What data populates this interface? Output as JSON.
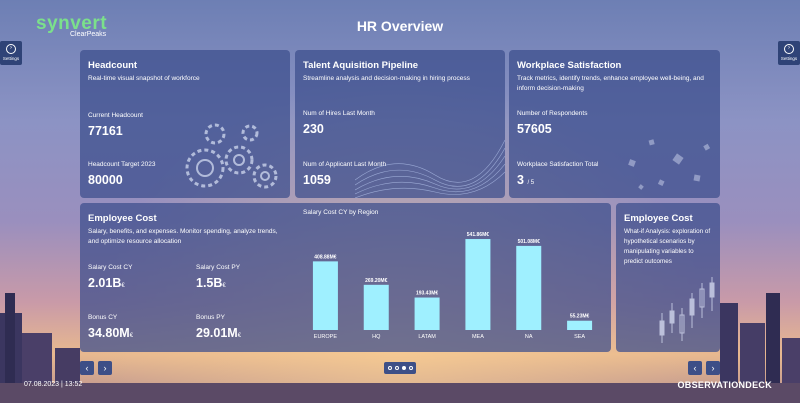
{
  "header": {
    "title": "HR Overview",
    "logo_main": "synvert",
    "logo_sub": "ClearPeaks"
  },
  "settings_left": {
    "label": "Settings"
  },
  "settings_right": {
    "label": "Settings"
  },
  "headcount": {
    "title": "Headcount",
    "desc": "Real-time visual snapshot of workforce",
    "current_label": "Current Headcount",
    "current_value": "77161",
    "target_label": "Headcount Target 2023",
    "target_value": "80000"
  },
  "talent": {
    "title": "Talent Aquisition Pipeline",
    "desc": "Streamline analysis and decision-making in hiring process",
    "hires_label": "Num of Hires Last Month",
    "hires_value": "230",
    "applicants_label": "Num of Applicant Last Month",
    "applicants_value": "1059"
  },
  "satisfaction": {
    "title": "Workplace Satisfaction",
    "desc": "Track metrics, identify trends, enhance employee well-being, and inform decision-making",
    "respondents_label": "Number of Respondents",
    "respondents_value": "57605",
    "total_label": "Workplace Satisfaction Total",
    "total_value": "3",
    "total_suffix": "/ 5"
  },
  "cost": {
    "title": "Employee Cost",
    "desc": "Salary, benefits, and expenses. Monitor spending, analyze trends, and optimize resource allocation",
    "salary_cy_label": "Salary Cost CY",
    "salary_cy_value": "2.01B",
    "salary_cy_unit": "€",
    "salary_py_label": "Salary Cost PY",
    "salary_py_value": "1.5B",
    "salary_py_unit": "€",
    "bonus_cy_label": "Bonus CY",
    "bonus_cy_value": "34.80M",
    "bonus_cy_unit": "€",
    "bonus_py_label": "Bonus PY",
    "bonus_py_value": "29.01M",
    "bonus_py_unit": "€"
  },
  "whatif": {
    "title": "Employee Cost",
    "desc": "What-if Analysis: exploration of hypothetical scenarios by manipulating variables to predict outcomes"
  },
  "chart_data": {
    "type": "bar",
    "title": "Salary Cost CY by Region",
    "categories": [
      "EUROPE",
      "HQ",
      "LATAM",
      "MEA",
      "NA",
      "SEA"
    ],
    "values": [
      408.88,
      269.2,
      193.43,
      541.86,
      501.08,
      55.23
    ],
    "labels": [
      "408.88M€",
      "269.20M€",
      "193.43M€",
      "541.86M€",
      "501.08M€",
      "55.23M€"
    ],
    "ylim": [
      0,
      560
    ],
    "bar_color": "#9ff0ff"
  },
  "footer": {
    "timestamp": "07.08.2023 | 13:52",
    "brand": "OBSERVATIONDECK"
  },
  "nav": {
    "prev": "‹",
    "next": "›"
  }
}
